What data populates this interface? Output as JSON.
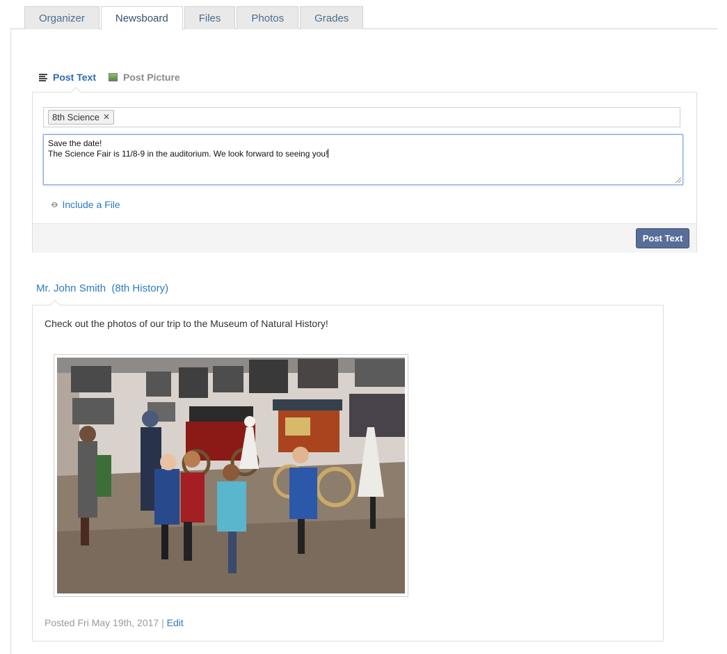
{
  "tabs": [
    {
      "label": "Organizer",
      "active": false
    },
    {
      "label": "Newsboard",
      "active": true
    },
    {
      "label": "Files",
      "active": false
    },
    {
      "label": "Photos",
      "active": false
    },
    {
      "label": "Grades",
      "active": false
    }
  ],
  "composer": {
    "post_types": {
      "text": "Post Text",
      "picture": "Post Picture",
      "selected": "text"
    },
    "recipient_tag": "8th Science",
    "message_lines": [
      "Save the date!",
      "The Science Fair is 11/8-9 in the auditorium. We look forward to seeing you!"
    ],
    "include_file_label": "Include a File",
    "post_button_label": "Post Text"
  },
  "news_item": {
    "author": "Mr. John Smith",
    "class_label": "(8th History)",
    "text": "Check out the photos of our trip to the Museum of Natural History!",
    "posted_label": "Posted Fri May 19th, 2017",
    "separator": "|",
    "edit_label": "Edit"
  },
  "colors": {
    "link": "#2b7bbf",
    "active_type": "#2b6cb0",
    "button": "#586e98",
    "focus_border": "#7fa7d8"
  },
  "icons": {
    "post_text": "text-lines-icon",
    "post_picture": "picture-icon",
    "include_file": "paperclip-icon",
    "remove_tag": "close-icon"
  }
}
